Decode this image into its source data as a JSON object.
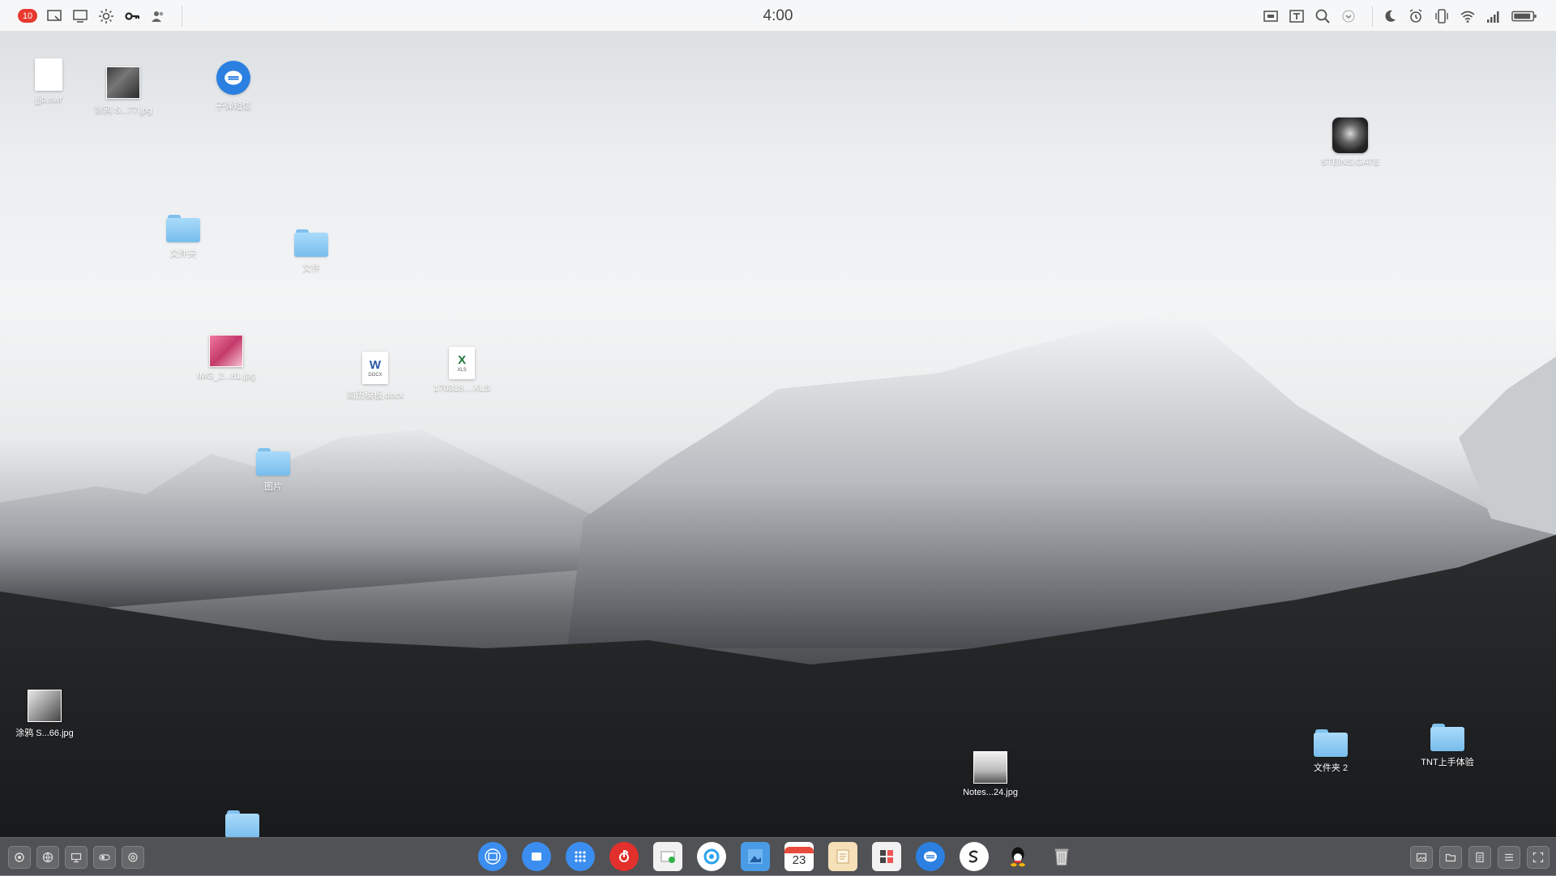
{
  "topbar": {
    "badge_count": "10",
    "clock": "4:00",
    "left_icons": [
      "screenshot-icon",
      "display-icon",
      "brightness-icon",
      "key-icon",
      "users-icon"
    ],
    "right_icons": [
      "screen-record-icon",
      "text-icon",
      "search-icon",
      "chevron-down-icon",
      "moon-icon",
      "alarm-icon",
      "vibrate-icon",
      "wifi-icon",
      "signal-icon",
      "battery-icon"
    ]
  },
  "desktop": {
    "items": [
      {
        "label": "jjjb.swf"
      },
      {
        "label": "涂鸦 S...77.jpg"
      },
      {
        "label": "子弹短信"
      },
      {
        "label": "STEINS;GATE"
      },
      {
        "label": "文件夹"
      },
      {
        "label": "文件"
      },
      {
        "label": "IMG_2...81.jpg"
      },
      {
        "label": "简历模板.docx"
      },
      {
        "label": "170318....XLS"
      },
      {
        "label": "图片"
      },
      {
        "label": "涂鸦 S...66.jpg"
      },
      {
        "label": "Notes...24.jpg"
      },
      {
        "label": "文件夹 2"
      },
      {
        "label": "TNT上手体验"
      }
    ]
  },
  "file_glyphs": {
    "docx": "W",
    "docx_ext": "DOCX",
    "xls": "X",
    "xls_ext": "XLS"
  },
  "dock": {
    "calendar_day": "23",
    "apps": [
      "notes-app",
      "screen-app",
      "launcher-app",
      "netease-music-app",
      "gallery-app",
      "browser-app",
      "photos-app",
      "calendar-app",
      "memo-app",
      "calculator-app",
      "bullet-messenger-app",
      "sogou-app",
      "qq-app",
      "trash-app"
    ]
  },
  "colors": {
    "badge": "#e8392f",
    "folder": "#8ccbf4",
    "accent_blue": "#2a7fe0"
  }
}
